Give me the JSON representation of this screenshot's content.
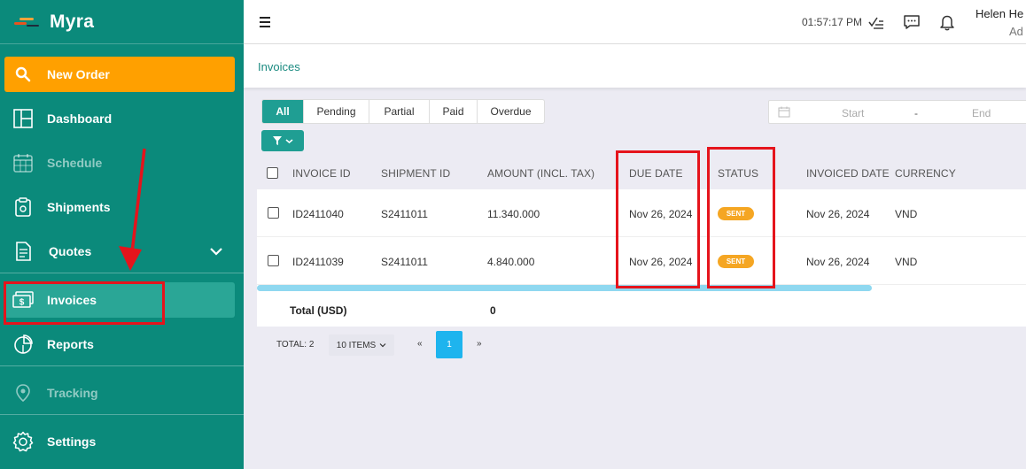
{
  "sidebar": {
    "brand": "Myra",
    "new_order": "New Order",
    "items": [
      {
        "label": "Dashboard",
        "icon": "dashboard-icon"
      },
      {
        "label": "Schedule",
        "icon": "calendar-icon"
      },
      {
        "label": "Shipments",
        "icon": "clipboard-icon"
      },
      {
        "label": "Quotes",
        "icon": "document-icon"
      },
      {
        "label": "Invoices",
        "icon": "money-icon"
      },
      {
        "label": "Reports",
        "icon": "pie-chart-icon"
      },
      {
        "label": "Tracking",
        "icon": "location-icon"
      },
      {
        "label": "Settings",
        "icon": "gear-icon"
      }
    ]
  },
  "header": {
    "time": "01:57:17 PM",
    "user_name": "Helen He",
    "user_role": "Ad"
  },
  "breadcrumb": "Invoices",
  "tabs": [
    "All",
    "Pending",
    "Partial",
    "Paid",
    "Overdue"
  ],
  "date_range": {
    "start": "Start",
    "separator": "-",
    "end": "End"
  },
  "table": {
    "columns": [
      "INVOICE ID",
      "SHIPMENT ID",
      "AMOUNT (INCL. TAX)",
      "DUE DATE",
      "STATUS",
      "INVOICED DATE",
      "CURRENCY"
    ],
    "rows": [
      {
        "invoice_id": "ID2411040",
        "shipment_id": "S2411011",
        "amount": "11.340.000",
        "due_date": "Nov 26, 2024",
        "status": "SENT",
        "invoiced_date": "Nov 26, 2024",
        "currency": "VND"
      },
      {
        "invoice_id": "ID2411039",
        "shipment_id": "S2411011",
        "amount": "4.840.000",
        "due_date": "Nov 26, 2024",
        "status": "SENT",
        "invoiced_date": "Nov 26, 2024",
        "currency": "VND"
      }
    ],
    "total_label": "Total (USD)",
    "total_value": "0"
  },
  "pagination": {
    "total": "TOTAL: 2",
    "page_size": "10 ITEMS",
    "prev": "«",
    "current": "1",
    "next": "»"
  },
  "colors": {
    "sidebar": "#0b8a7b",
    "accent_orange": "#ffa000",
    "teal_button": "#1f9e93",
    "status_sent": "#f5a623",
    "page_active": "#1eb4ee",
    "annotation_red": "#e5141c"
  }
}
